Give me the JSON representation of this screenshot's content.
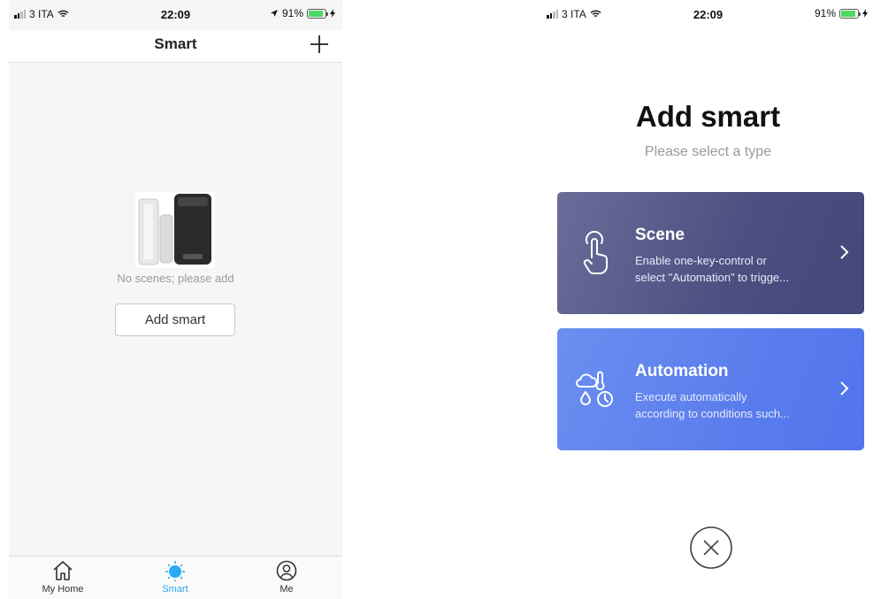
{
  "left": {
    "status": {
      "carrier": "3 ITA",
      "time": "22:09",
      "battery": "91%"
    },
    "navbar": {
      "title": "Smart"
    },
    "empty": {
      "text": "No scenes; please add",
      "button": "Add smart"
    },
    "tabs": [
      {
        "label": "My Home",
        "icon": "home-icon"
      },
      {
        "label": "Smart",
        "icon": "sun-icon",
        "active": true
      },
      {
        "label": "Me",
        "icon": "user-icon"
      }
    ],
    "colors": {
      "accent": "#2aa9f4"
    }
  },
  "right": {
    "status": {
      "carrier": "3 ITA",
      "time": "22:09",
      "battery": "91%"
    },
    "title": "Add smart",
    "subtitle": "Please select a type",
    "cards": [
      {
        "title": "Scene",
        "desc_line1": "Enable one-key-control or",
        "desc_line2": "select \"Automation\" to trigge...",
        "icon": "tap-hand-icon",
        "color": "#4b4f80"
      },
      {
        "title": "Automation",
        "desc_line1": "Execute automatically",
        "desc_line2": "according to conditions such...",
        "icon": "weather-clock-icon",
        "color": "#5a7ded"
      }
    ]
  }
}
